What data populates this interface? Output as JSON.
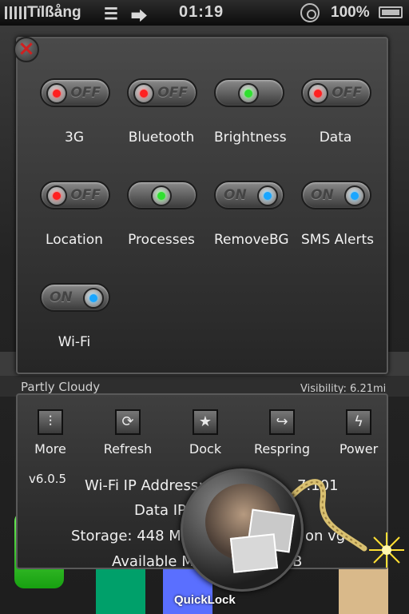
{
  "status_bar": {
    "carrier": "Tïlßång",
    "time": "01:19",
    "battery_percent": "100%"
  },
  "background": {
    "weather_condition": "Partly Cloudy",
    "visibility": "Visibility: 6.21mi"
  },
  "toggles": [
    {
      "label": "3G",
      "state": "OFF"
    },
    {
      "label": "Bluetooth",
      "state": "OFF"
    },
    {
      "label": "Brightness",
      "state": ""
    },
    {
      "label": "Data",
      "state": "OFF"
    },
    {
      "label": "Location",
      "state": "OFF"
    },
    {
      "label": "Processes",
      "state": ""
    },
    {
      "label": "RemoveBG",
      "state": "ON"
    },
    {
      "label": "SMS Alerts",
      "state": "ON"
    },
    {
      "label": "Wi-Fi",
      "state": "ON"
    }
  ],
  "actions": [
    {
      "label": "More",
      "icon": "sliders-icon"
    },
    {
      "label": "Refresh",
      "icon": "refresh-icon"
    },
    {
      "label": "Dock",
      "icon": "star-icon"
    },
    {
      "label": "Respring",
      "icon": "redo-icon"
    },
    {
      "label": "Power",
      "icon": "lightning-icon"
    }
  ],
  "info": {
    "version": "v6.0.5",
    "wifi_ip": "Wi-Fi IP Address:",
    "wifi_ip_tail": "7.101",
    "data_ip": "Data IP",
    "storage": "Storage: 448 M",
    "storage_tail": "on vg",
    "available": "Available M",
    "available_tail": "B"
  },
  "quicklock": {
    "label": "QuickLock"
  },
  "colors": {
    "off_led": "#ff2020",
    "on_led": "#1aa6ff",
    "neutral_led": "#30e030",
    "close_x": "#cf2020"
  }
}
